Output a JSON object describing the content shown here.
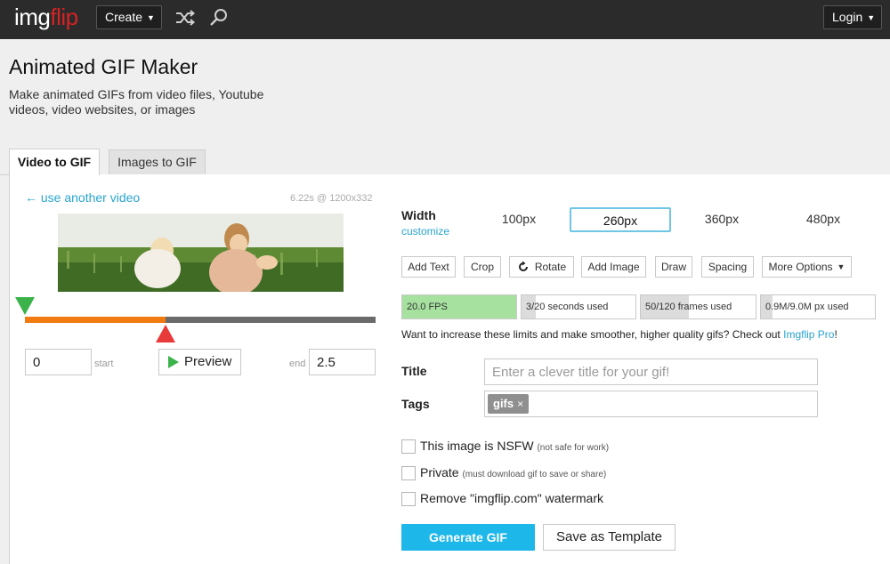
{
  "app": {
    "logo_part1": "img",
    "logo_part2": "flip",
    "create_label": "Create",
    "login_label": "Login"
  },
  "header": {
    "title": "Animated GIF Maker",
    "subtitle": "Make animated GIFs from video files, Youtube videos, video websites, or images"
  },
  "tabs": [
    {
      "label": "Video to GIF",
      "active": true
    },
    {
      "label": "Images to GIF",
      "active": false
    }
  ],
  "video": {
    "back_link": "← use another video",
    "meta": "6.22s @ 1200x332",
    "start_value": "0",
    "start_label": "start",
    "end_value": "2.5",
    "end_label": "end",
    "preview_label": "Preview",
    "selection_fraction": 0.4
  },
  "width": {
    "label": "Width",
    "customize": "customize",
    "options": [
      "100px",
      "260px",
      "360px",
      "480px"
    ],
    "selected": "260px"
  },
  "tools": {
    "add_text": "Add Text",
    "crop": "Crop",
    "rotate": "Rotate",
    "add_image": "Add Image",
    "draw": "Draw",
    "spacing": "Spacing",
    "more_options": "More Options"
  },
  "meters": [
    {
      "text": "20.0 FPS",
      "fraction": 1.0,
      "color": "#a6e1a0"
    },
    {
      "text": "3/20 seconds used",
      "fraction": 0.125,
      "color": "#dcdcdc"
    },
    {
      "text": "50/120 frames used",
      "fraction": 0.417,
      "color": "#dcdcdc"
    },
    {
      "text": "0.9M/9.0M px used",
      "fraction": 0.1,
      "color": "#dcdcdc"
    }
  ],
  "upsell": {
    "text": "Want to increase these limits and make smoother, higher quality gifs? Check out ",
    "link": "Imgflip Pro",
    "end": "!"
  },
  "form": {
    "title_label": "Title",
    "title_placeholder": "Enter a clever title for your gif!",
    "tags_label": "Tags",
    "tag": "gifs",
    "tag_remove": "×"
  },
  "options": {
    "nsfw_label": "This image is NSFW",
    "nsfw_note": "(not safe for work)",
    "private_label": "Private",
    "private_note": "(must download gif to save or share)",
    "watermark_label": "Remove \"imgflip.com\" watermark"
  },
  "actions": {
    "generate": "Generate GIF",
    "save_template": "Save as Template"
  },
  "colors": {
    "accent": "#1eb7e9",
    "link": "#2aa4cf",
    "track_fill": "#f17a11",
    "start_marker": "#3bb34a",
    "end_marker": "#e93a3a"
  }
}
